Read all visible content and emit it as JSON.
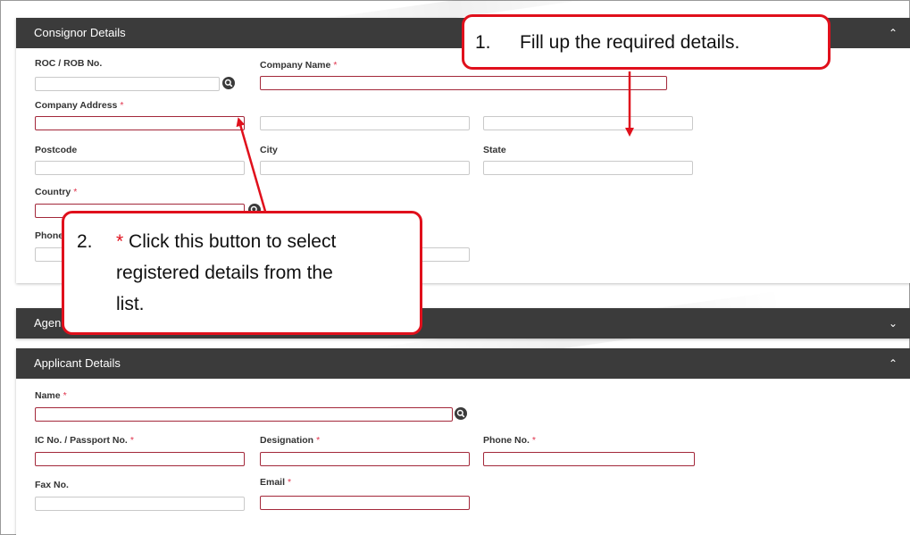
{
  "consignor": {
    "title": "Consignor Details",
    "roc_label": "ROC / ROB No.",
    "company_name_label": "Company Name",
    "company_address_label": "Company Address",
    "postcode_label": "Postcode",
    "city_label": "City",
    "state_label": "State",
    "country_label": "Country",
    "phone_label": "Phone"
  },
  "agent": {
    "title_partial": "Agen"
  },
  "applicant": {
    "title": "Applicant Details",
    "name_label": "Name",
    "ic_label": "IC No. / Passport No.",
    "designation_label": "Designation",
    "phone_label": "Phone No.",
    "fax_label": "Fax No.",
    "email_label": "Email"
  },
  "required_marker": "*",
  "callouts": {
    "one": {
      "number": "1.",
      "text": "Fill up the required details."
    },
    "two": {
      "number": "2.",
      "star": "*",
      "line1": "Click this button to select",
      "line2": "registered details from the",
      "line3": "list."
    }
  },
  "colors": {
    "header": "#3b3b3b",
    "required_border": "#a3283a",
    "callout_red": "#e0101c"
  },
  "icons": {
    "search": "search-icon",
    "collapse": "chevron-up-icon",
    "expand": "chevron-down-icon"
  }
}
